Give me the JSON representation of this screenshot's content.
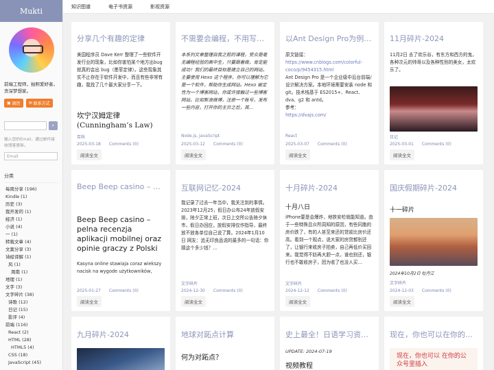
{
  "site": {
    "title": "Mukti"
  },
  "sidebar": {
    "bio": "前端工程师，拍照爱好者，贪深梦想家。",
    "btn_left": "周历",
    "btn_right": "联系方式",
    "search_placeholder": "",
    "subscribe_note": "输入您的Email，通过邮件接收博客更新。",
    "email_placeholder": "Email",
    "category_heading": "分类",
    "categories": [
      {
        "label": "每周分享 (196)",
        "level": 0
      },
      {
        "label": "Kindle (1)",
        "level": 0
      },
      {
        "label": "历史 (3)",
        "level": 0
      },
      {
        "label": "我开发的 (1)",
        "level": 0
      },
      {
        "label": "经济 (1)",
        "level": 0
      },
      {
        "label": "小说 (4)",
        "level": 0
      },
      {
        "label": "一 (1)",
        "level": 0
      },
      {
        "label": "转载文章 (4)",
        "level": 0
      },
      {
        "label": "文案分享 (3)",
        "level": 0
      },
      {
        "label": "诗经译解 (1)",
        "level": 0
      },
      {
        "label": "风 (1)",
        "level": 1
      },
      {
        "label": "周南 (1)",
        "level": 2
      },
      {
        "label": "地理 (1)",
        "level": 0
      },
      {
        "label": "文字 (3)",
        "level": 0
      },
      {
        "label": "文字碎片 (38)",
        "level": 0
      },
      {
        "label": "诗歌 (12)",
        "level": 1
      },
      {
        "label": "日记 (15)",
        "level": 1
      },
      {
        "label": "影评 (4)",
        "level": 1
      },
      {
        "label": "前端 (116)",
        "level": 0
      },
      {
        "label": "React (2)",
        "level": 1
      },
      {
        "label": "HTML (28)",
        "level": 1
      },
      {
        "label": "HTML5 (4)",
        "level": 2
      },
      {
        "label": "CSS (18)",
        "level": 1
      },
      {
        "label": "JavaScript (45)",
        "level": 1
      }
    ]
  },
  "topnav": [
    "知识图谱",
    "电子书资源",
    "影视资源"
  ],
  "read_more": "阅读全文",
  "cards": [
    {
      "title": "分享几个有趣的定律",
      "body_html": "美国程序员 Dave Kerr 整理了一些软件开发行业的现象，比如你害怕某个地方出bug 就真的会出 bug（墨菲定律）。这些现象其实不止存在于软件开发中，而且有些非常有趣，我找了几个最大家分享一下。",
      "big": "坎宁汉姆定律 (Cunningham’s Law)",
      "tags": "百科",
      "date": "2025-03-18",
      "comments": "Comments (0)"
    },
    {
      "title": "不需要会编程，不用写代码，",
      "body": "本系列文章整理自我之前的课程，受众是毫无编程经验的高中生，只要跟着做，肯定能成功！我们的最终目标是建立自己的网站，主要使用 Hexo 这个程序，你可以理解为它是一个软件，帮助你生成网站。Hexo 被定性为一个博客网站，你或许接触过一些博客网站，比如新浪微博，注册一个账号，发布一些内容，打开你的主页之后，其…",
      "tags": "Node.js, JavaScript",
      "date": "2025-03-12",
      "comments": "Comments (0)"
    },
    {
      "title": "以Ant Design Pro为例详细",
      "body_pre": "原文链接：",
      "link": "https://www.cnblogs.com/colorful-coco/p/9454315.html",
      "body": "Ant Design Pro 是一个企业级中后台前端/设计解决方案。本地环境需要安装 node 和 git。技术栈基于 ES2015+、React、dva、g2 和 antd。",
      "body_post": "参考：",
      "link2": "https://dvajs.com/",
      "tags": "React",
      "date": "2025-03-07",
      "comments": "Comments (0)"
    },
    {
      "title": "11月碎片-2024",
      "body": "11月2日 去了欢乐谷，有东方和西方的鬼，各种次元的帅哥以及各种性别的美女，太欢乐了。",
      "tags": "日记",
      "date": "2025-03-01",
      "comments": "Comments (0)"
    },
    {
      "title": "Beep Beep casino – pelna recenzja",
      "big": "Beep Beep casino – pelna recenzja aplikacji mobilnej oraz opinie graczy z Polski",
      "body": "Kasyna online stawiaja coraz wiekszy nacisk na wygode użytkowników,",
      "tags": "",
      "date": "2025-01-27",
      "comments": "Comments (0)"
    },
    {
      "title": "互联网记忆-2024",
      "body": "我记录了过去一年当中，我关注到的事情。2023年12月25，假日办公布24年放假安排，除夕正常上班，次日上交所公告除夕休市，假日办回应，放假安排仅作指导，最终放不放各单位自己说了算。2024年1月10日 网友：追无印良品说的最多的一句话：你猜这个多少钱？…",
      "tags": "文字碎片",
      "date": "2024-12-30",
      "comments": "Comments (0)"
    },
    {
      "title": "十月碎片-2024",
      "big": "十月八日",
      "body": "iPhone要是会爆炸，地铁安检就能知道。由于一些特殊且众所周知的原因，有些同胞的房价跌了，有的人甚至来还的贷款比房价还高。看到一个观点，说大家的房贷都别还了，让银行来收房子拍卖，自己再低价买回来。我觉得不妨再大胆一点，谁也别还，银行也不敢收房子，因为收了也没人买…",
      "tags": "文字碎片",
      "date": "2024-12-12",
      "comments": "Comments (0)"
    },
    {
      "title": "国庆假期碎片-2024",
      "big": "十一碎片",
      "caption": "2024年10月2日 牡丹江",
      "tags": "文字碎片",
      "date": "2024-12-03",
      "comments": "Comments (0)"
    },
    {
      "title": "九月碎片-2024"
    },
    {
      "title": "地球对跖点计算",
      "big": "何为对跖点？"
    },
    {
      "title": "史上最全！日语学习资料，",
      "update": "UPDATE: 2024-07-19",
      "big": "视频教程"
    },
    {
      "title": "现在，你也可以在你的公众号",
      "hand": "现在，你也可以 在你的公众号里插入"
    }
  ]
}
